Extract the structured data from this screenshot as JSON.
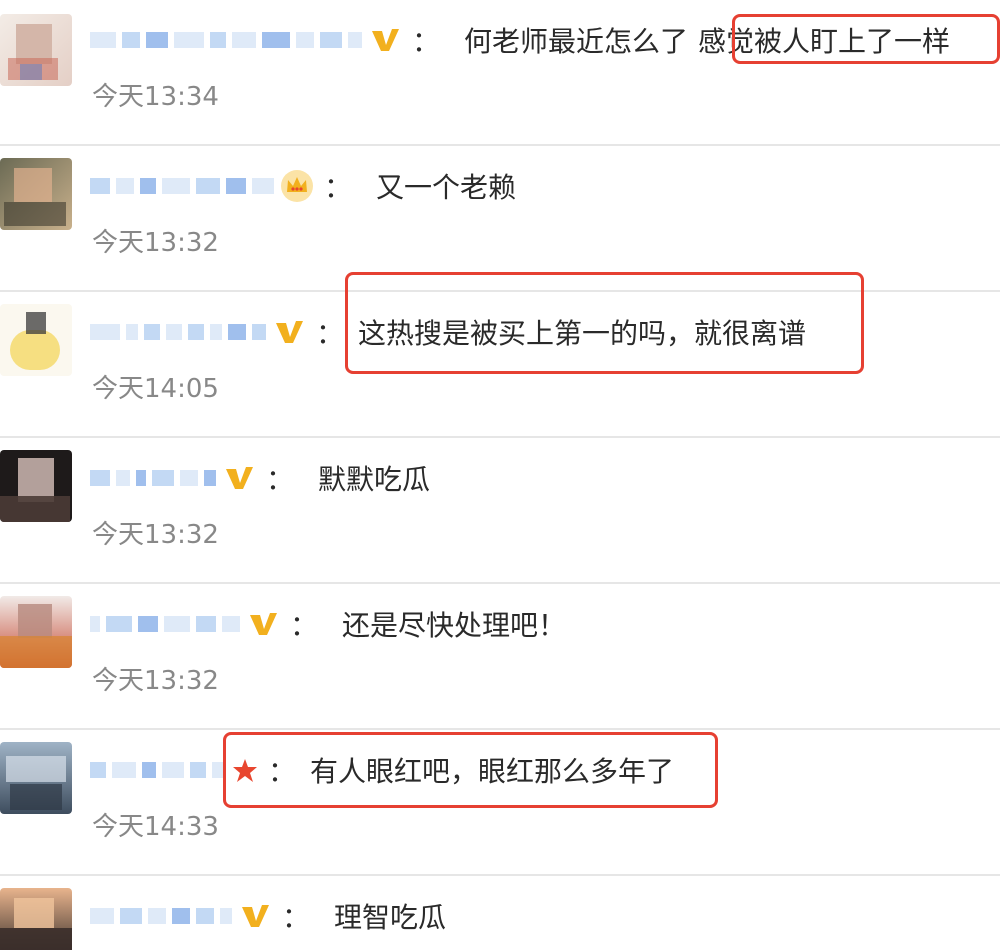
{
  "comments": [
    {
      "badge": "vip-v-icon",
      "colon": "：",
      "text_plain": "何老师最近怎么了",
      "text_highlight": "感觉被人盯上了一样",
      "time": "今天13:34"
    },
    {
      "badge": "crown-icon",
      "colon": "：",
      "text_plain": "又一个老赖",
      "text_highlight": "",
      "time": "今天13:32"
    },
    {
      "badge": "vip-v-icon",
      "colon": "：",
      "text_plain": "",
      "text_highlight": "这热搜是被买上第一的吗，就很离谱",
      "time": "今天14:05"
    },
    {
      "badge": "vip-v-icon",
      "colon": "：",
      "text_plain": "默默吃瓜",
      "text_highlight": "",
      "time": "今天13:32"
    },
    {
      "badge": "vip-v-icon",
      "colon": "：",
      "text_plain": "还是尽快处理吧！",
      "text_highlight": "",
      "time": "今天13:32"
    },
    {
      "badge": "star-icon",
      "colon": "：",
      "text_plain": "",
      "text_highlight": "有人眼红吧，眼红那么多年了",
      "time": "今天14:33"
    },
    {
      "badge": "vip-v-icon",
      "colon": "：",
      "text_plain": "理智吃瓜",
      "text_highlight": "",
      "time": ""
    }
  ],
  "colors": {
    "highlight_border": "#e64032",
    "vip_badge": "#f2b01e",
    "crown_badge": "#f2b01e",
    "star_badge": "#e8462f",
    "time_text": "#888888",
    "divider": "#e6e6e6"
  }
}
